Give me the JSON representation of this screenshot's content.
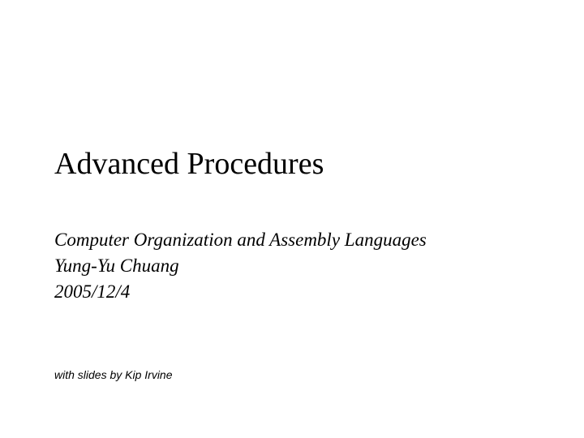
{
  "slide": {
    "title": "Advanced Procedures",
    "subtitle": {
      "course": "Computer Organization and Assembly Languages",
      "author": "Yung-Yu Chuang",
      "date": "2005/12/4"
    },
    "credit": "with slides by Kip Irvine"
  }
}
